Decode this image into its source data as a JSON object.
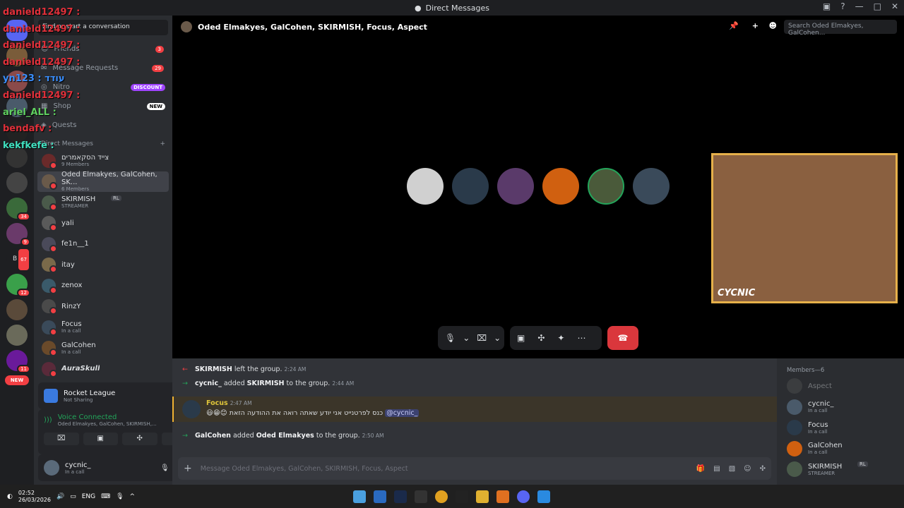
{
  "titlebar": {
    "title": "Direct Messages"
  },
  "sidebar": {
    "search": "Find or start a conversation",
    "nav": [
      {
        "label": "Friends",
        "badge": "3"
      },
      {
        "label": "Message Requests",
        "badge": "29"
      },
      {
        "label": "Nitro",
        "pill": "DISCOUNT"
      },
      {
        "label": "Shop",
        "pill": "NEW"
      },
      {
        "label": "Quests"
      }
    ],
    "dm_header": "Direct Messages",
    "dms": [
      {
        "name": "צייד הסקאמרים",
        "sub": "9 Members"
      },
      {
        "name": "Oded Elmakyes, GalCohen, SK...",
        "sub": "6 Members"
      },
      {
        "name": "SKIRMISH",
        "tag": "RL",
        "sub": "STREAMER"
      },
      {
        "name": "yali",
        "sub": ""
      },
      {
        "name": "fe1n__1",
        "sub": ""
      },
      {
        "name": "itay",
        "sub": ""
      },
      {
        "name": "zenox",
        "sub": ""
      },
      {
        "name": "RinzY",
        "sub": ""
      },
      {
        "name": "Focus",
        "sub": "In a call"
      },
      {
        "name": "GalCohen",
        "sub": "In a call"
      },
      {
        "name": "AuraSkull",
        "sub": ""
      }
    ],
    "activity": {
      "title": "Rocket League",
      "sub": "Not Sharing"
    },
    "voice": {
      "title": "Voice Connected",
      "sub": "Oded Elmakyes, GalCohen, SKIRMISH,..."
    },
    "user": {
      "name": "cycnic_",
      "status": "In a call"
    },
    "server_badges": [
      "34",
      "9",
      "67",
      "12",
      "11"
    ],
    "server_new": "NEW",
    "server_text": "B-I"
  },
  "overlay": [
    {
      "text": "danield12497 :",
      "color": "#e0303a"
    },
    {
      "text": "danield12497 :",
      "color": "#e0303a"
    },
    {
      "text": "danield12497 :",
      "color": "#e0303a"
    },
    {
      "text": "danield12497 :",
      "color": "#e0303a"
    },
    {
      "text": "yn123 : עודד",
      "color": "#3a8fff"
    },
    {
      "text": "danield12497 :",
      "color": "#e0303a"
    },
    {
      "text": "ariel_ALL :",
      "color": "#60d060"
    },
    {
      "text": "bendafv :",
      "color": "#e0303a"
    },
    {
      "text": "kekfkefe :",
      "color": "#40e0c0"
    }
  ],
  "call": {
    "header": "Oded Elmakyes, GalCohen, SKIRMISH, Focus, Aspect",
    "search_placeholder": "Search Oded Elmakyes, GalCohen...",
    "webcam_label": "CYCNIC"
  },
  "chat": {
    "messages": [
      {
        "user": "SKIRMISH",
        "text": "left the group.",
        "time": "2:24 AM",
        "kind": "leave"
      },
      {
        "user": "cycnic_",
        "text": "added",
        "target": "SKIRMISH",
        "tail": "to the group.",
        "time": "2:44 AM",
        "kind": "add"
      },
      {
        "user": "Focus",
        "time": "2:47 AM",
        "text": "כנס לפרטנייט אני יודע שאתה רואה את ההודעה הזאת",
        "mention": "@cycnic_",
        "kind": "message"
      },
      {
        "user": "GalCohen",
        "text": "added",
        "target": "Oded Elmakyes",
        "tail": "to the group.",
        "time": "2:50 AM",
        "kind": "add"
      }
    ],
    "input_placeholder": "Message Oded Elmakyes, GalCohen, SKIRMISH, Focus, Aspect"
  },
  "members": {
    "title": "Members—6",
    "list": [
      {
        "name": "Aspect",
        "sub": ""
      },
      {
        "name": "cycnic_",
        "sub": "In a call"
      },
      {
        "name": "Focus",
        "sub": "In a call"
      },
      {
        "name": "GalCohen",
        "sub": "In a call"
      },
      {
        "name": "SKIRMISH",
        "tag": "RL",
        "sub": "STREAMER"
      }
    ]
  },
  "taskbar": {
    "time": "02:52",
    "date": "26/03/2026",
    "lang": "ENG"
  }
}
